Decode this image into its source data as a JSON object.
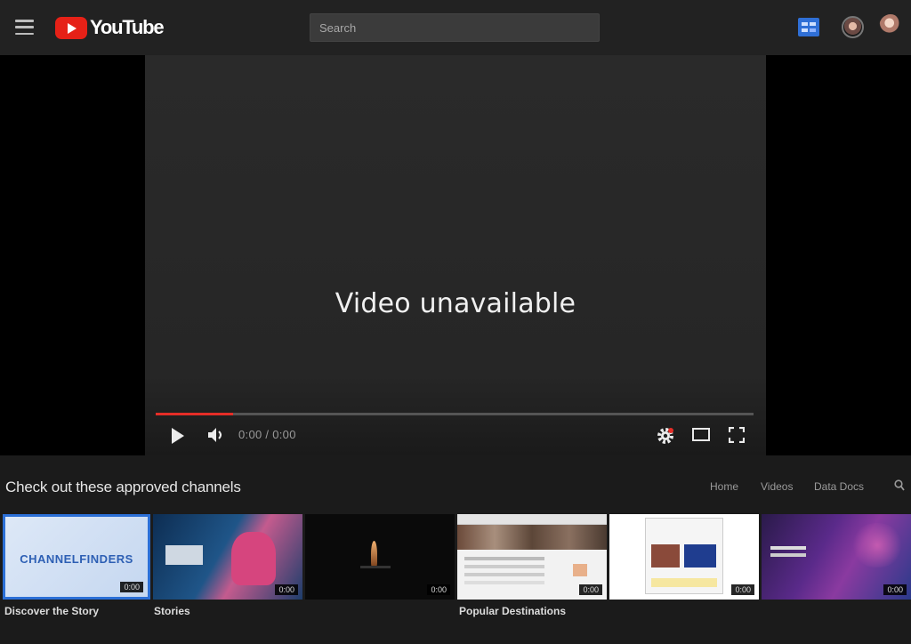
{
  "header": {
    "logo_text": "YouTube",
    "search_placeholder": "Search"
  },
  "player": {
    "message": "Video unavailable",
    "time_display": "0:00 / 0:00",
    "progress_fraction": 0.13,
    "progress_color": "#e52d27"
  },
  "shelf": {
    "title": "Check out these approved channels",
    "nav": [
      "Home",
      "Videos",
      "Data Docs"
    ],
    "videos": [
      {
        "title": "Discover the Story",
        "meta": "",
        "duration": "0:00",
        "thumb_text": "CHANNELFINDERS"
      },
      {
        "title": "Stories",
        "meta": "",
        "duration": "0:00"
      },
      {
        "title": "",
        "meta": "",
        "duration": "0:00"
      },
      {
        "title": "Popular Destinations",
        "meta": "",
        "duration": "0:00"
      },
      {
        "title": "",
        "meta": "",
        "duration": "0:00"
      },
      {
        "title": "",
        "meta": "",
        "duration": "0:00"
      }
    ]
  },
  "colors": {
    "header_bg": "#222222",
    "player_bg": "#2a2a2a",
    "brand_red": "#e62117",
    "accent_blue": "#2f6fd6"
  },
  "icons": [
    "menu-icon",
    "youtube-logo-icon",
    "apps-icon",
    "play-icon",
    "volume-icon",
    "gear-icon",
    "theater-mode-icon",
    "fullscreen-icon",
    "search-icon"
  ]
}
